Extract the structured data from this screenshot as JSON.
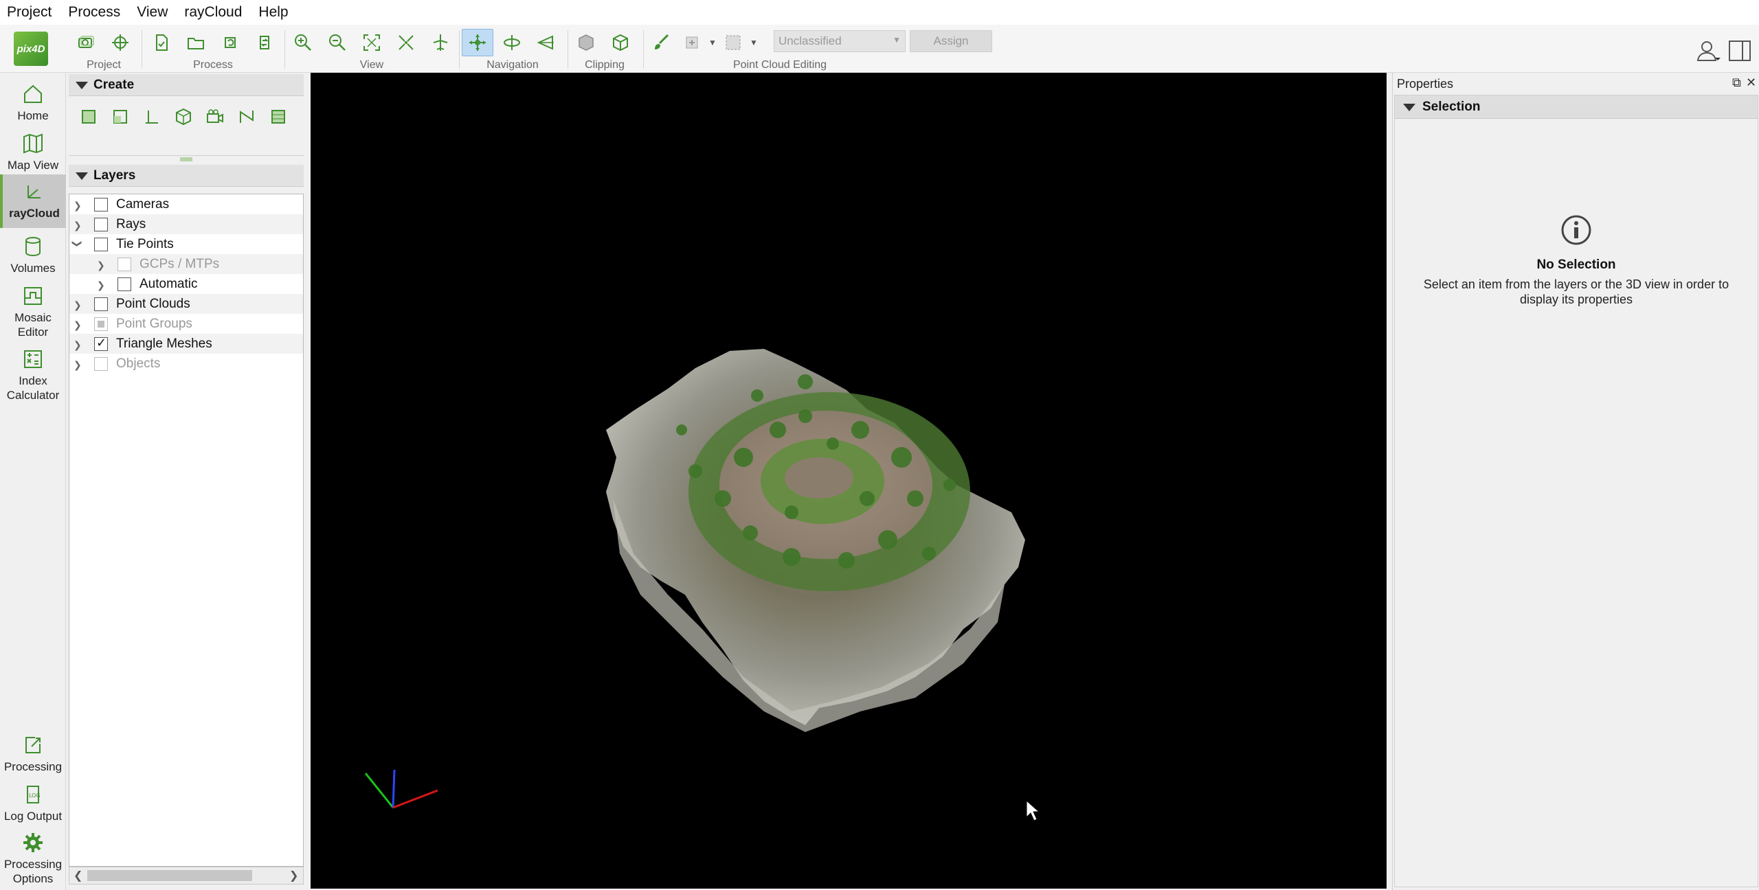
{
  "menu": [
    "Project",
    "Process",
    "View",
    "rayCloud",
    "Help"
  ],
  "logo": {
    "text": "pix4D"
  },
  "toolbar": {
    "groups": {
      "project": "Project",
      "process": "Process",
      "view": "View",
      "navigation": "Navigation",
      "clipping": "Clipping",
      "point_cloud_editing": "Point Cloud Editing"
    },
    "class_select": "Unclassified",
    "assign_label": "Assign"
  },
  "nav": {
    "home": "Home",
    "map_view": "Map View",
    "raycloud": "rayCloud",
    "volumes": "Volumes",
    "mosaic_editor": "Mosaic Editor",
    "index_calculator": "Index Calculator",
    "processing": "Processing",
    "log_output": "Log Output",
    "processing_options": "Processing Options"
  },
  "left_panel": {
    "create_title": "Create",
    "layers_title": "Layers",
    "layers": [
      {
        "label": "Cameras",
        "state": "unchecked",
        "expanded": false
      },
      {
        "label": "Rays",
        "state": "unchecked",
        "expanded": false
      },
      {
        "label": "Tie Points",
        "state": "unchecked",
        "expanded": true
      },
      {
        "label": "GCPs / MTPs",
        "state": "disabled",
        "expanded": false
      },
      {
        "label": "Automatic",
        "state": "unchecked",
        "expanded": false
      },
      {
        "label": "Point Clouds",
        "state": "unchecked",
        "expanded": false
      },
      {
        "label": "Point Groups",
        "state": "partial-disabled",
        "expanded": false
      },
      {
        "label": "Triangle Meshes",
        "state": "checked",
        "expanded": false
      },
      {
        "label": "Objects",
        "state": "disabled",
        "expanded": false
      }
    ]
  },
  "properties": {
    "title": "Properties",
    "section": "Selection",
    "no_selection": "No Selection",
    "message": "Select an item from the layers or the 3D view in order to display its properties"
  },
  "colors": {
    "accent_green": "#6aaa3a",
    "active_tool": "#bfdcf4",
    "viewport_bg": "#000000"
  }
}
